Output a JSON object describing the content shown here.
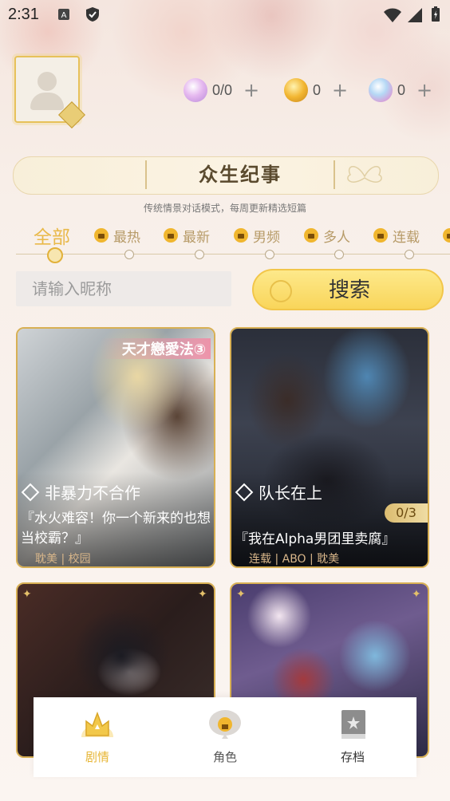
{
  "status_bar": {
    "time": "2:31"
  },
  "resources": [
    {
      "icon": "heart-gem-icon",
      "value": "0/0",
      "color": "#d9a6e6"
    },
    {
      "icon": "gold-coin-icon",
      "value": "0",
      "color": "#f2b632"
    },
    {
      "icon": "crystal-flower-icon",
      "value": "0",
      "color": "#9ec6f0"
    }
  ],
  "banner": {
    "title": "众生纪事",
    "subtitle": "传统情景对话模式，每周更新精选短篇"
  },
  "tabs": [
    {
      "label": "全部",
      "locked": false,
      "active": true
    },
    {
      "label": "最热",
      "locked": true
    },
    {
      "label": "最新",
      "locked": true
    },
    {
      "label": "男频",
      "locked": true
    },
    {
      "label": "多人",
      "locked": true
    },
    {
      "label": "连载",
      "locked": true
    },
    {
      "label": "",
      "locked": true
    }
  ],
  "search": {
    "placeholder": "请输入昵称",
    "button_label": "搜索"
  },
  "stories": [
    {
      "title": "非暴力不合作",
      "description": "『水火难容！你一个新来的也想当校霸？』",
      "tags": "耽美 | 校园",
      "banner": "天才戀愛法③",
      "progress": ""
    },
    {
      "title": "队长在上",
      "description": "『我在Alpha男团里卖腐』",
      "tags": "连载 | ABO | 耽美",
      "banner": "",
      "progress": "0/3"
    },
    {
      "title": "",
      "description": "",
      "tags": "",
      "banner": "",
      "progress": ""
    },
    {
      "title": "",
      "description": "",
      "tags": "",
      "banner": "",
      "progress": ""
    }
  ],
  "nav": [
    {
      "label": "剧情",
      "icon": "story-crown-icon",
      "active": true,
      "color": "#e7b636"
    },
    {
      "label": "角色",
      "icon": "character-lock-icon",
      "active": false,
      "color": "#555555"
    },
    {
      "label": "存档",
      "icon": "archive-book-icon",
      "active": false,
      "color": "#333333"
    }
  ]
}
